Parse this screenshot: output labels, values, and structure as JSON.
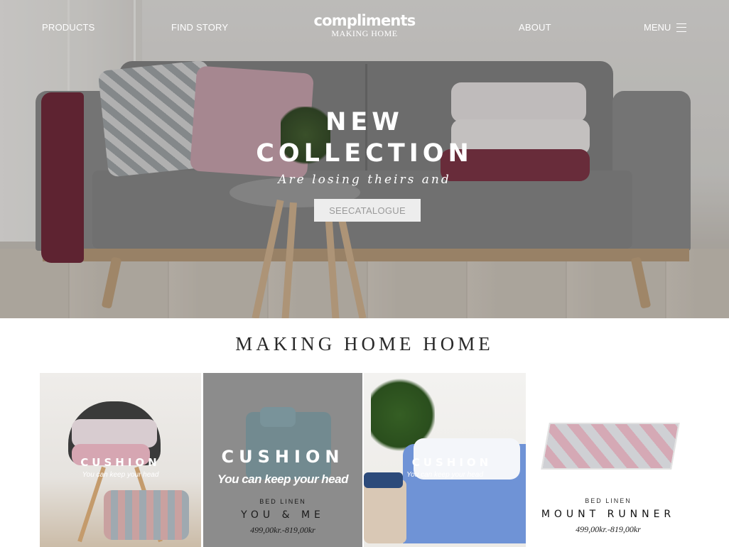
{
  "nav": {
    "products": "PRODUCTS",
    "find_story": "FIND STORY",
    "brand_name": "compliments",
    "brand_tagline": "MAKING HOME",
    "about": "ABOUT",
    "menu": "MENU"
  },
  "hero": {
    "title_line1": "NEW",
    "title_line2": "COLLECTION",
    "subtitle": "Are losing theirs and",
    "cta_label": "SEECATALOGUE"
  },
  "section": {
    "title": "MAKING HOME HOME"
  },
  "cards": [
    {
      "heading": "CUSHION",
      "tagline": "You can keep your head"
    },
    {
      "heading": "CUSHION",
      "tagline": "You can keep your head",
      "category": "BED LINEN",
      "name": "YOU & ME",
      "price": "499,00kr.-819,00kr"
    },
    {
      "heading": "CUSHION",
      "tagline": "You can keep your head"
    },
    {
      "category": "BED LINEN",
      "name": "MOUNT RUNNER",
      "price": "499,00kr.-819,00kr"
    }
  ],
  "colors": {
    "hero_text": "#ffffff",
    "cta_bg": "#ededed",
    "cta_text": "#9a9a9a",
    "section_title": "#2a2a2a",
    "card2_bg": "#8c8c8c"
  },
  "icons": {
    "menu": "hamburger-icon"
  }
}
